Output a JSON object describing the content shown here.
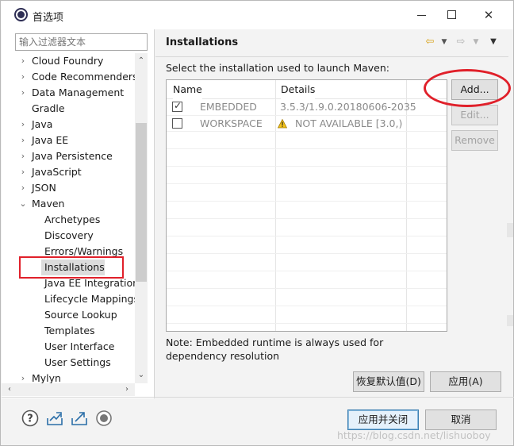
{
  "window": {
    "title": "首选项",
    "min_label": "",
    "max_label": "",
    "close_label": "✕"
  },
  "filter": {
    "placeholder": "输入过滤器文本"
  },
  "tree": {
    "items": [
      {
        "label": "Cloud Foundry",
        "arrow": "›"
      },
      {
        "label": "Code Recommenders",
        "arrow": "›"
      },
      {
        "label": "Data Management",
        "arrow": "›"
      },
      {
        "label": "Gradle",
        "arrow": ""
      },
      {
        "label": "Java",
        "arrow": "›"
      },
      {
        "label": "Java EE",
        "arrow": "›"
      },
      {
        "label": "Java Persistence",
        "arrow": "›"
      },
      {
        "label": "JavaScript",
        "arrow": "›"
      },
      {
        "label": "JSON",
        "arrow": "›"
      },
      {
        "label": "Maven",
        "arrow": "⌄"
      },
      {
        "label": "Archetypes",
        "arrow": ""
      },
      {
        "label": "Discovery",
        "arrow": ""
      },
      {
        "label": "Errors/Warnings",
        "arrow": ""
      },
      {
        "label": "Installations",
        "arrow": ""
      },
      {
        "label": "Java EE Integration",
        "arrow": ""
      },
      {
        "label": "Lifecycle Mappings",
        "arrow": ""
      },
      {
        "label": "Source Lookup",
        "arrow": ""
      },
      {
        "label": "Templates",
        "arrow": ""
      },
      {
        "label": "User Interface",
        "arrow": ""
      },
      {
        "label": "User Settings",
        "arrow": ""
      },
      {
        "label": "Mylyn",
        "arrow": "›"
      }
    ]
  },
  "page": {
    "title": "Installations",
    "description": "Select the installation used to launch Maven:",
    "note": "Note: Embedded runtime is always used for dependency resolution"
  },
  "table": {
    "headers": {
      "name": "Name",
      "details": "Details"
    },
    "rows": [
      {
        "checked": true,
        "name": "EMBEDDED",
        "details": "3.5.3/1.9.0.20180606-2035",
        "warning": false
      },
      {
        "checked": false,
        "name": "WORKSPACE",
        "details": "NOT AVAILABLE [3.0,)",
        "warning": true
      }
    ]
  },
  "buttons": {
    "add": "Add...",
    "edit": "Edit...",
    "remove": "Remove",
    "restore_defaults": "恢复默认值(D)",
    "apply": "应用(A)",
    "apply_close": "应用并关闭",
    "cancel": "取消"
  },
  "watermark": "https://blog.csdn.net/lishuoboy",
  "colors": {
    "annotation_red": "#e0202a",
    "primary_button_border": "#3c7fb1"
  }
}
